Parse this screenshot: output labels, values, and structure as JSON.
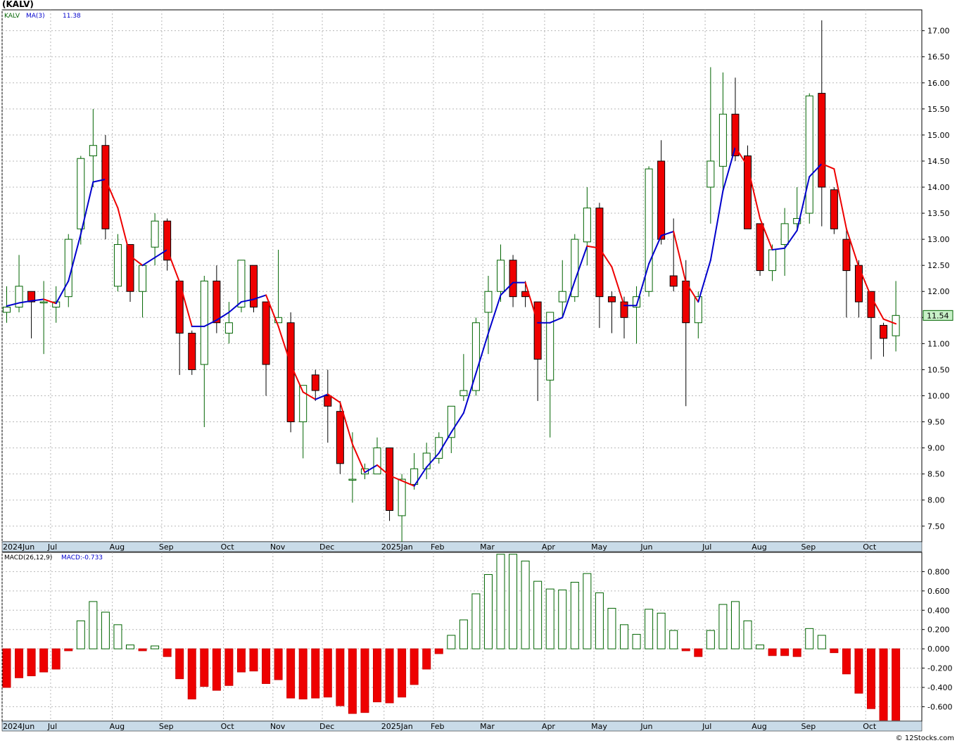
{
  "header": {
    "ticker_title": "(KALV)"
  },
  "price_panel": {
    "legend_symbol": "KALV",
    "legend_ma_label": "MA(3)",
    "legend_ma_value": "11.38",
    "last_price_tag": "11.54",
    "up_color": "#006400",
    "down_color": "#ee0000",
    "ma_up_color": "#0000cc",
    "ma_down_color": "#ee0000"
  },
  "macd_panel": {
    "legend_label": "MACD(26,12,9)",
    "legend_value": "MACD:-0.733"
  },
  "footer": {
    "watermark": "© 12Stocks.com"
  },
  "chart_data": [
    {
      "type": "candlestick",
      "title": "(KALV)",
      "ylim": [
        7.2,
        17.4
      ],
      "y_ticks": [
        "7.50",
        "8.00",
        "8.50",
        "9.00",
        "9.50",
        "10.00",
        "10.50",
        "11.00",
        "11.50",
        "12.00",
        "12.50",
        "13.00",
        "13.50",
        "14.00",
        "14.50",
        "15.00",
        "15.50",
        "16.00",
        "16.50",
        "17.00"
      ],
      "x_month_labels": [
        "2024Jun",
        "Jul",
        "Aug",
        "Sep",
        "Oct",
        "Nov",
        "Dec",
        "2025Jan",
        "Feb",
        "Mar",
        "Apr",
        "May",
        "Jun",
        "Jul",
        "Aug",
        "Sep",
        "Oct"
      ],
      "month_start_index": [
        0,
        4,
        9,
        13,
        18,
        22,
        26,
        31,
        35,
        39,
        44,
        48,
        52,
        57,
        61,
        65,
        70
      ],
      "candles": [
        {
          "o": 11.6,
          "h": 12.1,
          "l": 11.4,
          "c": 11.7
        },
        {
          "o": 11.7,
          "h": 12.7,
          "l": 11.6,
          "c": 12.1
        },
        {
          "o": 12.0,
          "h": 12.0,
          "l": 11.1,
          "c": 11.8
        },
        {
          "o": 11.8,
          "h": 12.2,
          "l": 10.8,
          "c": 11.8
        },
        {
          "o": 11.7,
          "h": 12.1,
          "l": 11.4,
          "c": 11.8
        },
        {
          "o": 11.9,
          "h": 13.1,
          "l": 11.7,
          "c": 13.0
        },
        {
          "o": 13.2,
          "h": 14.6,
          "l": 12.9,
          "c": 14.55
        },
        {
          "o": 14.6,
          "h": 15.5,
          "l": 14.0,
          "c": 14.8
        },
        {
          "o": 14.8,
          "h": 15.0,
          "l": 13.0,
          "c": 13.2
        },
        {
          "o": 12.1,
          "h": 13.1,
          "l": 12.0,
          "c": 12.9
        },
        {
          "o": 12.9,
          "h": 12.9,
          "l": 11.8,
          "c": 12.0
        },
        {
          "o": 12.0,
          "h": 12.5,
          "l": 11.5,
          "c": 12.5
        },
        {
          "o": 12.85,
          "h": 13.5,
          "l": 12.5,
          "c": 13.35
        },
        {
          "o": 13.35,
          "h": 13.4,
          "l": 12.4,
          "c": 12.6
        },
        {
          "o": 12.2,
          "h": 12.2,
          "l": 10.4,
          "c": 11.2
        },
        {
          "o": 11.2,
          "h": 11.25,
          "l": 10.4,
          "c": 10.5
        },
        {
          "o": 10.6,
          "h": 12.3,
          "l": 9.4,
          "c": 12.2
        },
        {
          "o": 12.2,
          "h": 12.5,
          "l": 11.2,
          "c": 11.4
        },
        {
          "o": 11.2,
          "h": 11.8,
          "l": 11.0,
          "c": 11.4
        },
        {
          "o": 11.7,
          "h": 12.6,
          "l": 11.6,
          "c": 12.6
        },
        {
          "o": 12.5,
          "h": 12.5,
          "l": 11.6,
          "c": 11.7
        },
        {
          "o": 11.8,
          "h": 11.8,
          "l": 10.0,
          "c": 10.6
        },
        {
          "o": 11.4,
          "h": 12.8,
          "l": 11.4,
          "c": 11.5
        },
        {
          "o": 11.4,
          "h": 11.6,
          "l": 9.3,
          "c": 9.5
        },
        {
          "o": 9.5,
          "h": 10.2,
          "l": 8.8,
          "c": 10.2
        },
        {
          "o": 10.4,
          "h": 10.5,
          "l": 9.9,
          "c": 10.1
        },
        {
          "o": 10.0,
          "h": 10.5,
          "l": 9.1,
          "c": 9.8
        },
        {
          "o": 9.7,
          "h": 9.9,
          "l": 8.5,
          "c": 8.7
        },
        {
          "o": 8.4,
          "h": 9.3,
          "l": 7.95,
          "c": 8.4
        },
        {
          "o": 8.5,
          "h": 8.7,
          "l": 8.4,
          "c": 8.6
        },
        {
          "o": 8.5,
          "h": 9.2,
          "l": 8.5,
          "c": 9.0
        },
        {
          "o": 9.0,
          "h": 9.0,
          "l": 7.6,
          "c": 7.8
        },
        {
          "o": 7.7,
          "h": 8.5,
          "l": 7.2,
          "c": 8.4
        },
        {
          "o": 8.3,
          "h": 8.9,
          "l": 8.2,
          "c": 8.6
        },
        {
          "o": 8.6,
          "h": 9.1,
          "l": 8.4,
          "c": 8.9
        },
        {
          "o": 8.8,
          "h": 9.3,
          "l": 8.7,
          "c": 9.2
        },
        {
          "o": 9.2,
          "h": 9.7,
          "l": 8.9,
          "c": 9.8
        },
        {
          "o": 10.0,
          "h": 10.8,
          "l": 9.9,
          "c": 10.1
        },
        {
          "o": 10.1,
          "h": 11.5,
          "l": 10.0,
          "c": 11.4
        },
        {
          "o": 11.6,
          "h": 12.3,
          "l": 10.8,
          "c": 12.0
        },
        {
          "o": 12.0,
          "h": 12.9,
          "l": 11.8,
          "c": 12.6
        },
        {
          "o": 12.6,
          "h": 12.7,
          "l": 11.7,
          "c": 11.9
        },
        {
          "o": 12.0,
          "h": 12.2,
          "l": 11.7,
          "c": 11.9
        },
        {
          "o": 11.8,
          "h": 11.8,
          "l": 9.9,
          "c": 10.7
        },
        {
          "o": 10.3,
          "h": 11.6,
          "l": 9.2,
          "c": 11.6
        },
        {
          "o": 11.8,
          "h": 12.6,
          "l": 11.5,
          "c": 12.0
        },
        {
          "o": 11.9,
          "h": 13.1,
          "l": 11.8,
          "c": 13.0
        },
        {
          "o": 12.95,
          "h": 14.0,
          "l": 12.5,
          "c": 13.6
        },
        {
          "o": 13.6,
          "h": 13.7,
          "l": 11.3,
          "c": 11.9
        },
        {
          "o": 11.9,
          "h": 12.0,
          "l": 11.2,
          "c": 11.8
        },
        {
          "o": 11.8,
          "h": 11.9,
          "l": 11.1,
          "c": 11.5
        },
        {
          "o": 11.7,
          "h": 12.1,
          "l": 11.0,
          "c": 11.9
        },
        {
          "o": 12.0,
          "h": 14.4,
          "l": 11.9,
          "c": 14.35
        },
        {
          "o": 14.5,
          "h": 14.9,
          "l": 12.9,
          "c": 13.0
        },
        {
          "o": 12.3,
          "h": 13.4,
          "l": 12.0,
          "c": 12.1
        },
        {
          "o": 12.2,
          "h": 12.6,
          "l": 9.8,
          "c": 11.4
        },
        {
          "o": 11.4,
          "h": 12.0,
          "l": 11.1,
          "c": 11.9
        },
        {
          "o": 14.0,
          "h": 16.3,
          "l": 13.3,
          "c": 14.5
        },
        {
          "o": 14.4,
          "h": 16.2,
          "l": 13.9,
          "c": 15.4
        },
        {
          "o": 15.4,
          "h": 16.1,
          "l": 14.5,
          "c": 14.6
        },
        {
          "o": 14.6,
          "h": 14.8,
          "l": 13.2,
          "c": 13.2
        },
        {
          "o": 13.3,
          "h": 13.3,
          "l": 12.3,
          "c": 12.4
        },
        {
          "o": 12.4,
          "h": 12.9,
          "l": 12.2,
          "c": 12.8
        },
        {
          "o": 12.9,
          "h": 13.6,
          "l": 12.3,
          "c": 13.3
        },
        {
          "o": 13.3,
          "h": 14.0,
          "l": 13.2,
          "c": 13.4
        },
        {
          "o": 13.5,
          "h": 15.8,
          "l": 13.3,
          "c": 15.75
        },
        {
          "o": 15.8,
          "h": 17.2,
          "l": 13.25,
          "c": 14.0
        },
        {
          "o": 13.95,
          "h": 14.0,
          "l": 13.1,
          "c": 13.2
        },
        {
          "o": 13.0,
          "h": 13.2,
          "l": 11.5,
          "c": 12.4
        },
        {
          "o": 12.5,
          "h": 12.6,
          "l": 11.5,
          "c": 11.8
        },
        {
          "o": 12.0,
          "h": 12.0,
          "l": 10.7,
          "c": 11.5
        },
        {
          "o": 11.35,
          "h": 11.4,
          "l": 10.75,
          "c": 11.1
        },
        {
          "o": 11.15,
          "h": 12.2,
          "l": 10.85,
          "c": 11.54
        }
      ],
      "ma3": [
        11.72,
        11.78,
        11.82,
        11.85,
        11.77,
        12.2,
        13.1,
        14.1,
        14.15,
        13.6,
        12.68,
        12.5,
        12.65,
        12.8,
        12.18,
        11.33,
        11.33,
        11.45,
        11.6,
        11.8,
        11.85,
        11.93,
        11.33,
        10.6,
        10.07,
        9.93,
        10.03,
        9.87,
        9.07,
        8.53,
        8.67,
        8.47,
        8.37,
        8.27,
        8.63,
        8.9,
        9.3,
        9.67,
        10.43,
        11.2,
        11.93,
        12.17,
        12.17,
        11.4,
        11.4,
        11.5,
        12.2,
        12.87,
        12.83,
        12.47,
        11.73,
        11.73,
        12.53,
        13.07,
        13.15,
        12.17,
        11.8,
        12.6,
        13.93,
        14.77,
        14.4,
        13.4,
        12.8,
        12.83,
        13.17,
        14.2,
        14.45,
        14.35,
        13.2,
        12.47,
        11.9,
        11.47,
        11.38
      ]
    },
    {
      "type": "bar",
      "title": "MACD(26,12,9)",
      "ylim": [
        -0.75,
        1.0
      ],
      "y_ticks": [
        "-0.600",
        "-0.400",
        "-0.200",
        "0.000",
        "0.200",
        "0.400",
        "0.600",
        "0.800"
      ],
      "x_month_labels": [
        "2024Jun",
        "Jul",
        "Aug",
        "Sep",
        "Oct",
        "Nov",
        "Dec",
        "2025Jan",
        "Feb",
        "Mar",
        "Apr",
        "May",
        "Jun",
        "Jul",
        "Aug",
        "Sep",
        "Oct"
      ],
      "values": [
        -0.4,
        -0.3,
        -0.28,
        -0.24,
        -0.21,
        -0.02,
        0.29,
        0.49,
        0.38,
        0.25,
        0.04,
        -0.02,
        0.03,
        -0.08,
        -0.31,
        -0.52,
        -0.39,
        -0.43,
        -0.38,
        -0.24,
        -0.23,
        -0.36,
        -0.32,
        -0.51,
        -0.52,
        -0.51,
        -0.5,
        -0.59,
        -0.67,
        -0.66,
        -0.55,
        -0.56,
        -0.5,
        -0.37,
        -0.21,
        -0.05,
        0.14,
        0.3,
        0.57,
        0.77,
        0.98,
        0.98,
        0.91,
        0.7,
        0.62,
        0.61,
        0.69,
        0.78,
        0.58,
        0.42,
        0.25,
        0.15,
        0.41,
        0.37,
        0.19,
        -0.02,
        -0.08,
        0.19,
        0.46,
        0.49,
        0.29,
        0.04,
        -0.07,
        -0.07,
        -0.08,
        0.21,
        0.14,
        -0.04,
        -0.26,
        -0.46,
        -0.62,
        -0.74,
        -0.74
      ]
    }
  ]
}
